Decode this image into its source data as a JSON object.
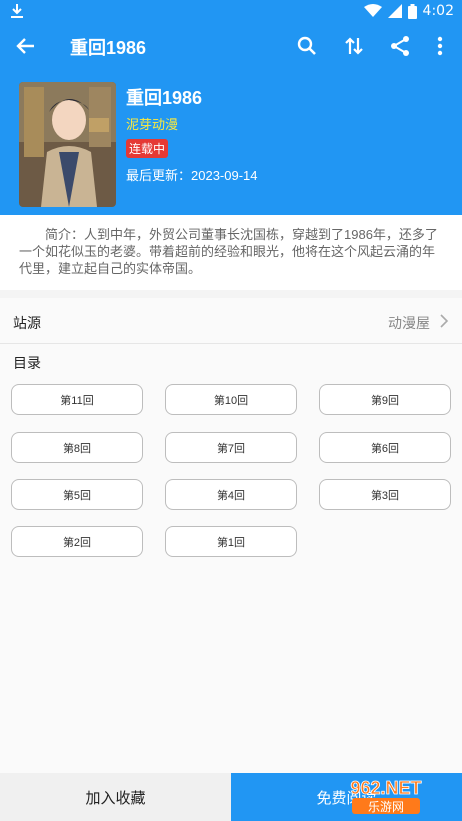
{
  "status_bar": {
    "time": "4:02",
    "icons": [
      "download-icon",
      "wifi-icon",
      "signal-icon",
      "battery-icon"
    ]
  },
  "appbar": {
    "title": "重回1986",
    "icons": [
      "back-arrow-icon",
      "search-icon",
      "sort-icon",
      "share-icon",
      "more-vert-icon"
    ]
  },
  "book": {
    "title": "重回1986",
    "author": "泥芽动漫",
    "status": "连载中",
    "updated": "最后更新：2023-09-14",
    "intro": "简介：人到中年，外贸公司董事长沈国栋，穿越到了1986年，还多了一个如花似玉的老婆。带着超前的经验和眼光，他将在这个风起云涌的年代里，建立起自己的实体帝国。"
  },
  "source": {
    "label": "站源",
    "value": "动漫屋"
  },
  "toc": {
    "label": "目录",
    "chapters": [
      "第11回",
      "第10回",
      "第9回",
      "第8回",
      "第7回",
      "第6回",
      "第5回",
      "第4回",
      "第3回",
      "第2回",
      "第1回"
    ]
  },
  "bottom": {
    "favorite_label": "加入收藏",
    "read_label": "免费阅读"
  },
  "watermark": {
    "brand": "962.NET",
    "sub": "乐游网"
  },
  "colors": {
    "primary": "#2196f3",
    "author": "#ffeb3b",
    "badge": "#e53935"
  }
}
